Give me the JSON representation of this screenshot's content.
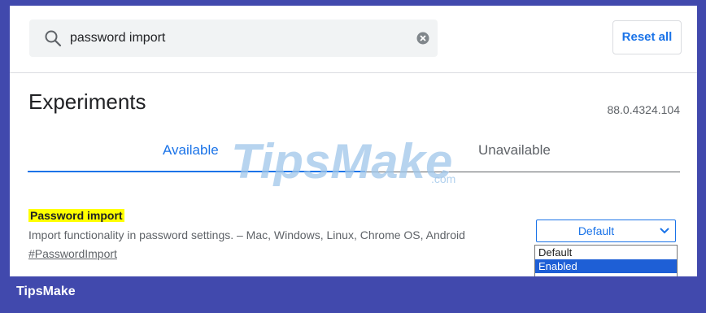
{
  "search": {
    "query": "password import",
    "search_icon": "magnifier",
    "clear_icon": "clear-circle"
  },
  "header": {
    "reset_label": "Reset all"
  },
  "page": {
    "title": "Experiments",
    "version": "88.0.4324.104"
  },
  "tabs": [
    {
      "label": "Available",
      "active": true
    },
    {
      "label": "Unavailable",
      "active": false
    }
  ],
  "feature": {
    "name": "Password import",
    "description": "Import functionality in password settings. – Mac, Windows, Linux, Chrome OS, Android",
    "link": "#PasswordImport",
    "select_value": "Default",
    "options": [
      {
        "label": "Default"
      },
      {
        "label": "Enabled",
        "selected": true
      }
    ]
  },
  "watermark": {
    "brand": "TipsMake",
    "suffix": ".com"
  },
  "footer": {
    "brand": "TipsMake"
  },
  "colors": {
    "accent": "#1a73e8",
    "frame": "#4149ad",
    "highlight": "#ffff00",
    "selected_option": "#1e5fd6"
  }
}
